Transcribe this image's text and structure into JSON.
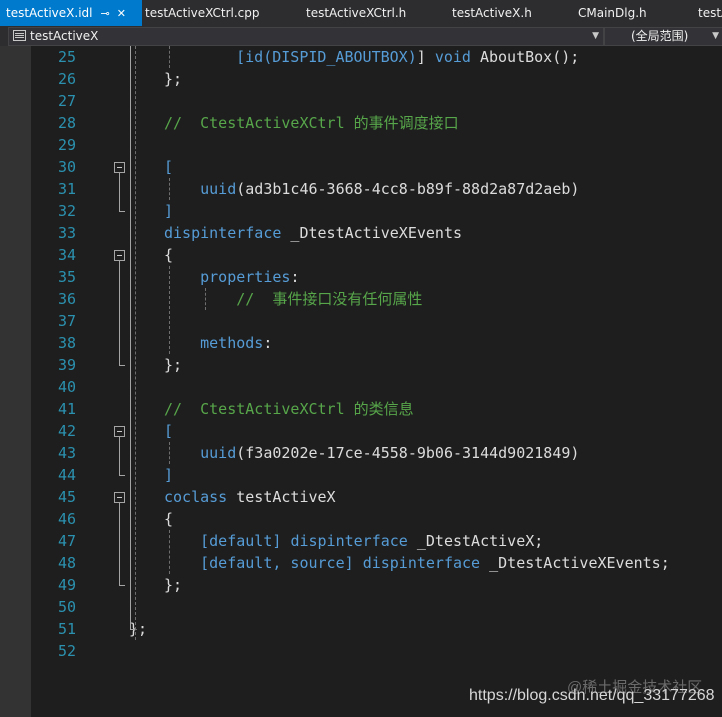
{
  "tabs": [
    {
      "label": "testActiveX.idl",
      "pin": "⊸",
      "close": "✕",
      "active": true
    },
    {
      "label": "testActiveXCtrl.cpp",
      "active": false
    },
    {
      "label": "testActiveXCtrl.h",
      "active": false
    },
    {
      "label": "testActiveX.h",
      "active": false
    },
    {
      "label": "CMainDlg.h",
      "active": false
    },
    {
      "label": "testA",
      "active": false
    }
  ],
  "nav": {
    "project": "testActiveX",
    "scope": "(全局范围)"
  },
  "lines": [
    {
      "n": "25",
      "tokens": [
        {
          "t": "    "
        },
        {
          "t": "[",
          "c": "kw"
        },
        {
          "t": "id(DISPID_ABOUTBOX)",
          "c": "kw"
        },
        {
          "t": "] "
        },
        {
          "t": "void",
          "c": "kw"
        },
        {
          "t": " AboutBox();"
        }
      ]
    },
    {
      "n": "26",
      "tokens": [
        {
          "t": "};"
        }
      ]
    },
    {
      "n": "27",
      "tokens": []
    },
    {
      "n": "28",
      "tokens": [
        {
          "t": "//  CtestActiveXCtrl 的事件调度接口",
          "c": "cm"
        }
      ]
    },
    {
      "n": "29",
      "tokens": []
    },
    {
      "n": "30",
      "tokens": [
        {
          "t": "[",
          "c": "kw"
        }
      ]
    },
    {
      "n": "31",
      "tokens": [
        {
          "t": "    "
        },
        {
          "t": "uuid",
          "c": "kw"
        },
        {
          "t": "(ad3b1c46-3668-4cc8-b89f-88d2a87d2aeb)"
        }
      ]
    },
    {
      "n": "32",
      "tokens": [
        {
          "t": "]",
          "c": "kw"
        }
      ]
    },
    {
      "n": "33",
      "tokens": [
        {
          "t": "dispinterface",
          "c": "kw"
        },
        {
          "t": " _DtestActiveXEvents"
        }
      ]
    },
    {
      "n": "34",
      "tokens": [
        {
          "t": "{"
        }
      ]
    },
    {
      "n": "35",
      "tokens": [
        {
          "t": "    "
        },
        {
          "t": "properties",
          "c": "kw"
        },
        {
          "t": ":"
        }
      ]
    },
    {
      "n": "36",
      "tokens": [
        {
          "t": "        "
        },
        {
          "t": "//  事件接口没有任何属性",
          "c": "cm"
        }
      ]
    },
    {
      "n": "37",
      "tokens": []
    },
    {
      "n": "38",
      "tokens": [
        {
          "t": "    "
        },
        {
          "t": "methods",
          "c": "kw"
        },
        {
          "t": ":"
        }
      ]
    },
    {
      "n": "39",
      "tokens": [
        {
          "t": "};"
        }
      ]
    },
    {
      "n": "40",
      "tokens": []
    },
    {
      "n": "41",
      "tokens": [
        {
          "t": "//  CtestActiveXCtrl 的类信息",
          "c": "cm"
        }
      ]
    },
    {
      "n": "42",
      "tokens": [
        {
          "t": "[",
          "c": "kw"
        }
      ]
    },
    {
      "n": "43",
      "tokens": [
        {
          "t": "    "
        },
        {
          "t": "uuid",
          "c": "kw"
        },
        {
          "t": "(f3a0202e-17ce-4558-9b06-3144d9021849)"
        }
      ]
    },
    {
      "n": "44",
      "tokens": [
        {
          "t": "]",
          "c": "kw"
        }
      ]
    },
    {
      "n": "45",
      "tokens": [
        {
          "t": "coclass",
          "c": "kw"
        },
        {
          "t": " testActiveX"
        }
      ]
    },
    {
      "n": "46",
      "tokens": [
        {
          "t": "{"
        }
      ]
    },
    {
      "n": "47",
      "tokens": [
        {
          "t": "    "
        },
        {
          "t": "[default]",
          "c": "kw"
        },
        {
          "t": " "
        },
        {
          "t": "dispinterface",
          "c": "kw"
        },
        {
          "t": " _DtestActiveX;"
        }
      ]
    },
    {
      "n": "48",
      "tokens": [
        {
          "t": "    "
        },
        {
          "t": "[default, source]",
          "c": "kw"
        },
        {
          "t": " "
        },
        {
          "t": "dispinterface",
          "c": "kw"
        },
        {
          "t": " _DtestActiveXEvents;"
        }
      ]
    },
    {
      "n": "49",
      "tokens": [
        {
          "t": "};"
        }
      ]
    },
    {
      "n": "50",
      "tokens": []
    },
    {
      "n": "51",
      "tokens": [
        {
          "t": "};"
        }
      ]
    },
    {
      "n": "52",
      "tokens": []
    }
  ],
  "watermark": {
    "line1": "@稀土掘金技术社区",
    "line2": "https://blog.csdn.net/qq_33177268"
  }
}
